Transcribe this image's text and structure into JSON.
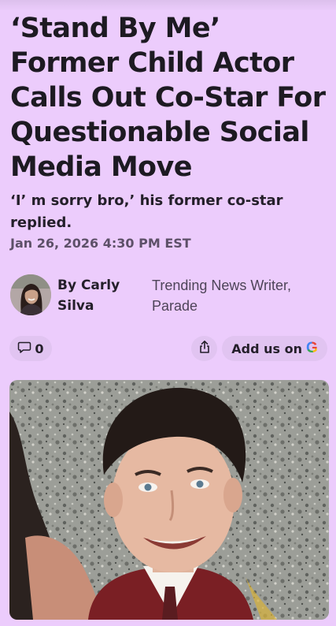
{
  "article": {
    "headline": "‘Stand By Me’ Former Child Actor Calls Out Co-Star For Questionable Social Media Move",
    "subheadline": "‘I’ m sorry bro,’ his former co-star replied.",
    "date": "Jan 26, 2026 4:30 PM EST"
  },
  "author": {
    "name": "By Carly Silva",
    "role": "Trending News Writer, Parade",
    "avatar_icon": "author-avatar"
  },
  "actions": {
    "comment_icon": "comment-icon",
    "comment_count": "0",
    "share_icon": "share-icon",
    "google_label": "Add us on",
    "google_logo": "G"
  },
  "colors": {
    "background": "#ecccfc",
    "pill": "#e1c4f1",
    "text": "#1d1a22",
    "date": "#5d5068"
  }
}
